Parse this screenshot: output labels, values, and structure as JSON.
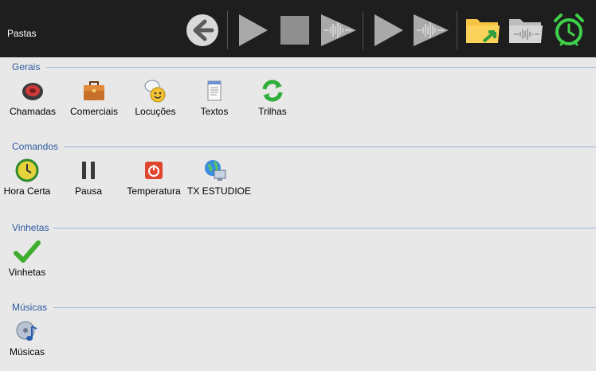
{
  "window": {
    "title": "Pastas"
  },
  "toolbar": {
    "buttons": [
      {
        "icon": "back-arrow-icon"
      },
      {
        "icon": "play-icon"
      },
      {
        "icon": "stop-icon"
      },
      {
        "icon": "play-waveform-icon"
      },
      {
        "icon": "play-icon"
      },
      {
        "icon": "play-waveform-icon"
      },
      {
        "icon": "folder-open-icon"
      },
      {
        "icon": "folder-audio-icon"
      },
      {
        "icon": "alarm-clock-icon"
      }
    ]
  },
  "sections": [
    {
      "title": "Gerais",
      "items": [
        {
          "label": "Chamadas",
          "icon": "speaker-icon"
        },
        {
          "label": "Comerciais",
          "icon": "briefcase-icon"
        },
        {
          "label": "Locuções",
          "icon": "chat-smiley-icon"
        },
        {
          "label": "Textos",
          "icon": "notepad-icon"
        },
        {
          "label": "Trilhas",
          "icon": "refresh-arrows-icon"
        }
      ]
    },
    {
      "title": "Comandos",
      "items": [
        {
          "label": "Hora Certa",
          "icon": "clock-icon"
        },
        {
          "label": "Pausa",
          "icon": "pause-icon"
        },
        {
          "label": "Temperatura",
          "icon": "power-icon"
        },
        {
          "label": "TX ESTUDIOE",
          "icon": "network-globe-icon"
        }
      ]
    },
    {
      "title": "Vinhetas",
      "items": [
        {
          "label": "Vinhetas",
          "icon": "checkmark-icon"
        }
      ]
    },
    {
      "title": "Músicas",
      "items": [
        {
          "label": "Músicas",
          "icon": "music-disc-icon"
        }
      ]
    }
  ],
  "colors": {
    "topbar": "#1e1e1e",
    "section_title": "#2d5aa0",
    "section_line": "#9bb4d8",
    "background": "#e8e8e8"
  }
}
